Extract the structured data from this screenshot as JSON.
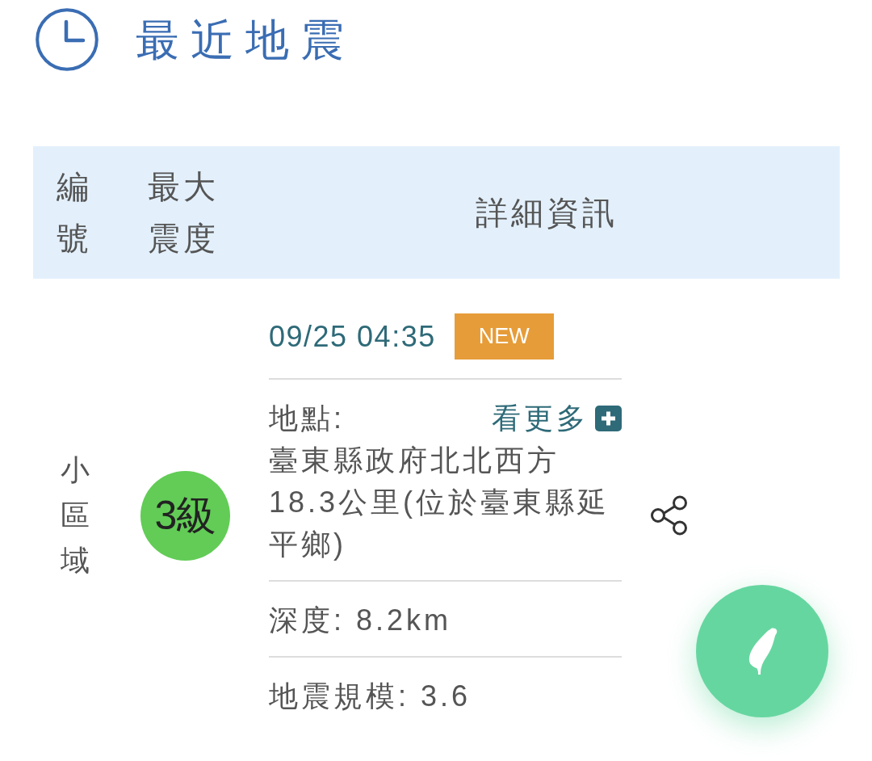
{
  "header": {
    "title": "最近地震"
  },
  "table": {
    "columns": [
      "編號",
      "最大震度",
      "詳細資訊"
    ],
    "rows": [
      {
        "area": "小區域",
        "intensity": "3級",
        "color": "#62cc56",
        "time": "09/25 04:35",
        "badge": "NEW",
        "details": [
          {
            "kind": "location",
            "label": "地點:",
            "more": "看更多",
            "value": "臺東縣政府北北西方18.3公里(位於臺東縣延平鄉)"
          },
          {
            "kind": "text",
            "text": "深度: 8.2km"
          },
          {
            "kind": "text",
            "text": "地震規模: 3.6"
          }
        ]
      }
    ]
  }
}
